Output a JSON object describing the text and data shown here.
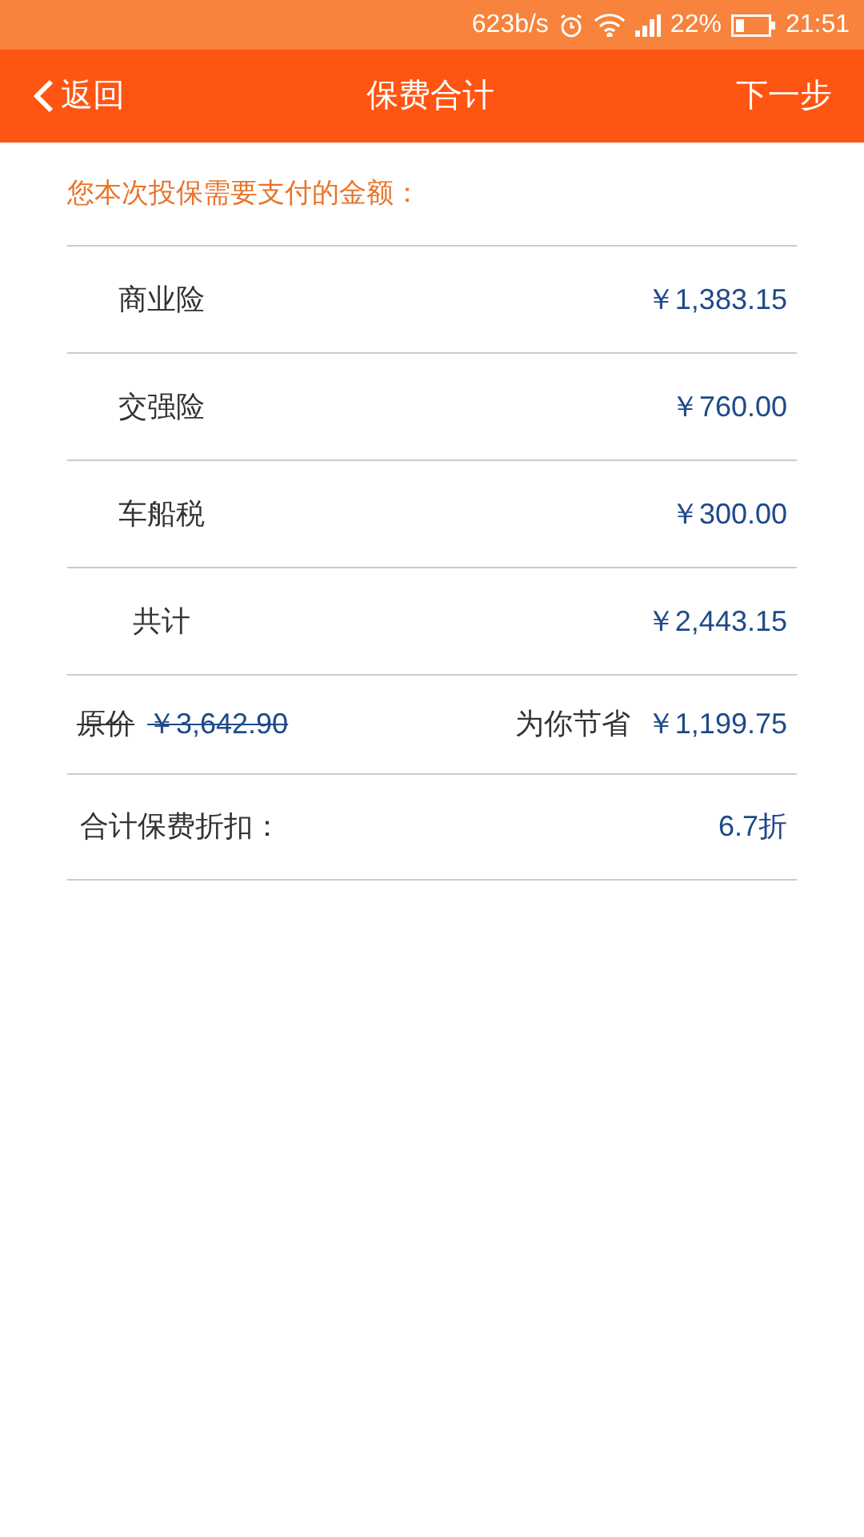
{
  "status_bar": {
    "speed": "623b/s",
    "battery": "22%",
    "time": "21:51"
  },
  "header": {
    "back": "返回",
    "title": "保费合计",
    "next": "下一步"
  },
  "prompt": "您本次投保需要支付的金额：",
  "items": [
    {
      "label": "商业险",
      "amount": "￥1,383.15"
    },
    {
      "label": "交强险",
      "amount": "￥760.00"
    },
    {
      "label": "车船税",
      "amount": "￥300.00"
    },
    {
      "label": "共计",
      "amount": "￥2,443.15"
    }
  ],
  "original": {
    "label": "原价",
    "amount": "￥3,642.90",
    "saved_label": "为你节省",
    "saved_amount": "￥1,199.75"
  },
  "discount": {
    "label": "合计保费折扣：",
    "value": "6.7折"
  }
}
